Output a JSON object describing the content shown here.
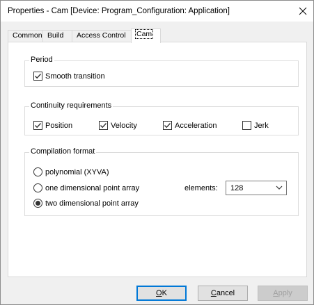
{
  "window": {
    "title": "Properties - Cam [Device: Program_Configuration: Application]"
  },
  "tabs": [
    {
      "label": "Common",
      "active": false
    },
    {
      "label": "Build",
      "active": false
    },
    {
      "label": "Access Control",
      "active": false
    },
    {
      "label": "Cam",
      "active": true
    }
  ],
  "period": {
    "title": "Period",
    "smooth_transition": {
      "label": "Smooth transition",
      "checked": true
    }
  },
  "continuity": {
    "title": "Continuity requirements",
    "items": [
      {
        "label": "Position",
        "checked": true
      },
      {
        "label": "Velocity",
        "checked": true
      },
      {
        "label": "Acceleration",
        "checked": true
      },
      {
        "label": "Jerk",
        "checked": false
      }
    ]
  },
  "compilation": {
    "title": "Compilation format",
    "options": [
      {
        "label": "polynomial (XYVA)",
        "selected": false
      },
      {
        "label": "one dimensional point array",
        "selected": false
      },
      {
        "label": "two dimensional point array",
        "selected": true
      }
    ],
    "elements_label": "elements:",
    "elements_value": "128"
  },
  "buttons": {
    "ok_prefix": "",
    "ok_hotkey": "O",
    "ok_rest": "K",
    "cancel_hotkey": "C",
    "cancel_rest": "ancel",
    "apply_hotkey": "A",
    "apply_rest": "pply"
  },
  "icons": {
    "close": "close-icon",
    "check": "checkmark-icon",
    "dropdown": "chevron-down-icon"
  }
}
